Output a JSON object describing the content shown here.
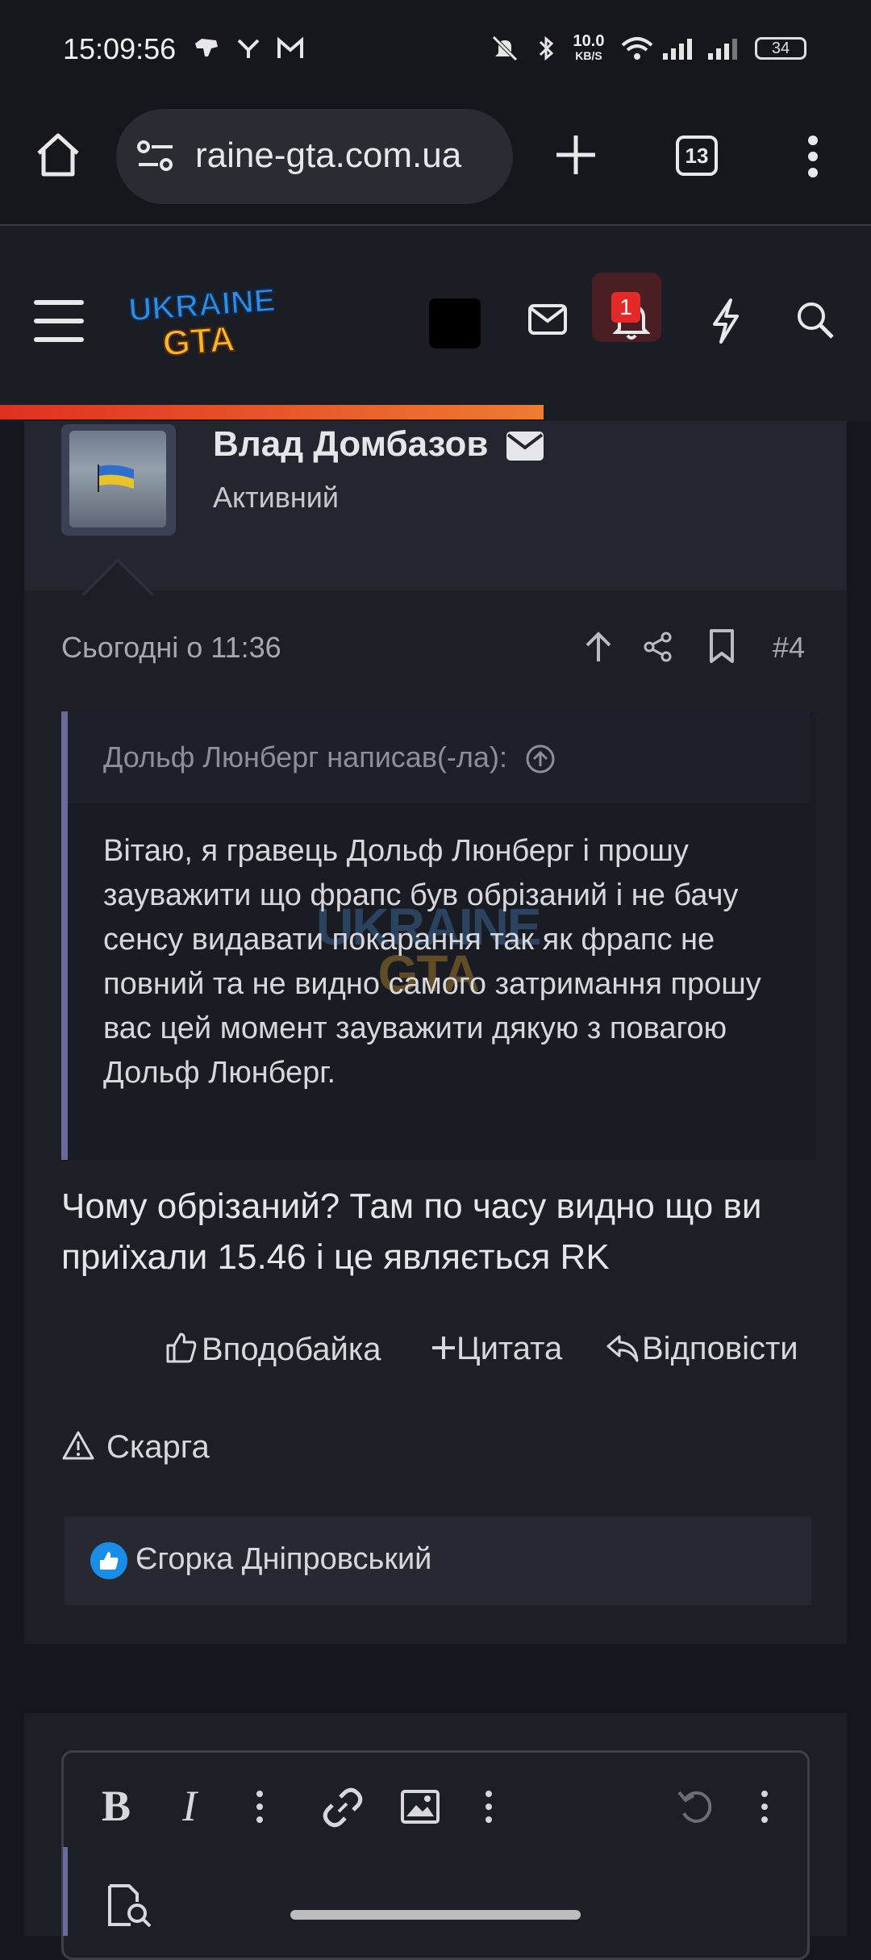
{
  "status_bar": {
    "time": "15:09:56",
    "net_speed_value": "10.0",
    "net_speed_unit": "KB/S",
    "battery": "34"
  },
  "browser": {
    "url": "raine-gta.com.ua",
    "tab_count": "13"
  },
  "site_header": {
    "logo_line1": "UKRAINE",
    "logo_line2": "GTA",
    "notification_count": "1",
    "accent_color": "#e52828"
  },
  "post": {
    "username": "Влад Домбазов",
    "user_title": "Активний",
    "date": "Сьогодні о 11:36",
    "number": "#4",
    "quote_author": "Дольф Люнберг написав(-ла):",
    "quote_text": "Вітаю, я гравець Дольф Люнберг і прошу зауважити що фрапс був обрізаний і не бачу сенсу видавати покарання так як фрапс не повний та не видно самого затримання прошу вас цей момент зауважити дякую з повагою Дольф Люнберг.",
    "watermark_line1": "UKRAINE",
    "watermark_line2": "GTA",
    "body": "Чому обрізаний? Там по часу видно що ви приїхали 15.46 і це являється RK",
    "actions": {
      "like": "Вподобайка",
      "quote": "Цитата",
      "reply": "Відповісти",
      "report": "Скарга"
    },
    "liked_by": "Єгорка Дніпровський"
  },
  "editor": {
    "bold_label": "B",
    "italic_label": "I"
  }
}
